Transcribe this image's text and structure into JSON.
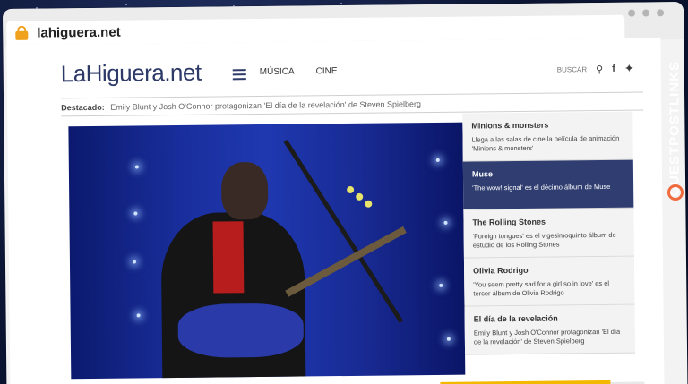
{
  "browser": {
    "url": "lahiguera.net"
  },
  "header": {
    "logo": "LaHiguera.net",
    "nav": [
      "MÚSICA",
      "CINE"
    ],
    "search_label": "BUSCAR"
  },
  "destacado": {
    "label": "Destacado:",
    "text": "Emily Blunt y Josh O'Connor protagonizan 'El día de la revelación' de Steven Spielberg"
  },
  "sidebar": {
    "items": [
      {
        "title": "Minions & monsters",
        "desc": "Llega a las salas de cine la película de animación 'Minions & monsters'"
      },
      {
        "title": "Muse",
        "desc": "'The wow! signal' es el décimo álbum de Muse"
      },
      {
        "title": "The Rolling Stones",
        "desc": "'Foreign tongues' es el vigesimoquinto álbum de estudio de los Rolling Stones"
      },
      {
        "title": "Olivia Rodrigo",
        "desc": "'You seem pretty sad for a girl so in love' es el tercer álbum de Olivia Rodrigo"
      },
      {
        "title": "El día de la revelación",
        "desc": "Emily Blunt y Josh O'Connor protagonizan 'El día de la revelación' de Steven Spielberg"
      }
    ]
  },
  "branding": {
    "text": "GUESTPOSTLINKS"
  },
  "icons": {
    "lock": "lock-icon",
    "menu": "menu-icon",
    "search": "search-icon",
    "facebook": "facebook-icon",
    "twitter": "twitter-icon"
  },
  "colors": {
    "brand": "#2d3a68",
    "active_item": "#2f3d70",
    "accent": "#f3b900",
    "lock": "#f0a21d"
  }
}
